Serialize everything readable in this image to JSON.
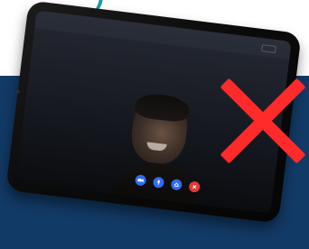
{
  "colors": {
    "background_light": "#ffffff",
    "background_navy": "#123a66",
    "accent_teal": "#1a9aa8",
    "control_blue": "#2f6cf3",
    "control_red": "#e23a3a",
    "cross_red": "#ff2b2b"
  },
  "icons": {
    "controls": [
      "video-camera-icon",
      "microphone-icon",
      "share-icon",
      "end-call-icon"
    ],
    "overlay": "red-cross-icon"
  }
}
